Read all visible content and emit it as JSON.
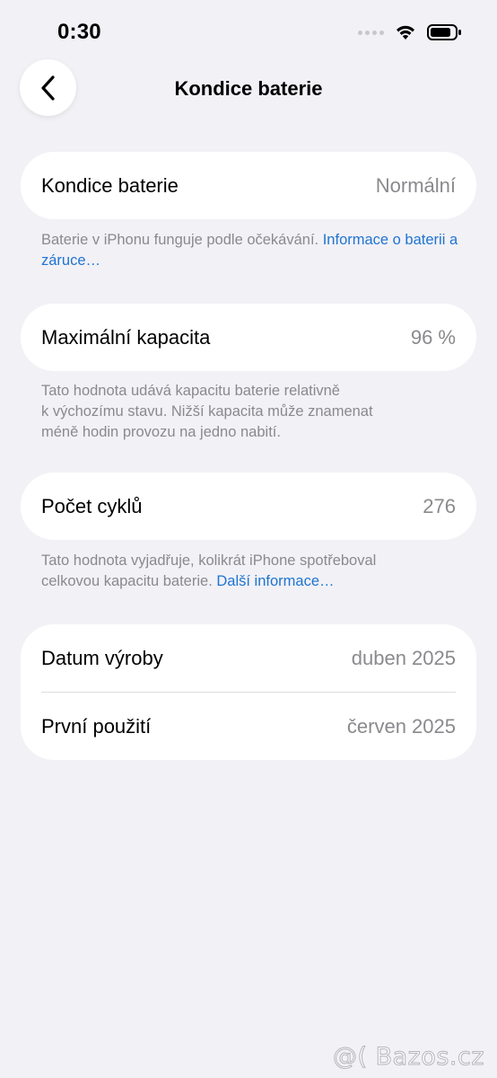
{
  "status_bar": {
    "time": "0:30",
    "icons": [
      "signal-dots-icon",
      "wifi-icon",
      "battery-icon"
    ]
  },
  "nav": {
    "back_icon": "chevron-left-icon",
    "title": "Kondice baterie"
  },
  "health": {
    "label": "Kondice baterie",
    "value": "Normální",
    "note": "Baterie v iPhonu funguje podle očekávání. ",
    "note_link": "Informace o baterii a záruce…"
  },
  "capacity": {
    "label": "Maximální kapacita",
    "value": "96 %",
    "note_lines": [
      "Tato hodnota udává kapacitu baterie relativně",
      "k výchozímu stavu. Nižší kapacita může znamenat",
      "méně hodin provozu na jedno nabití."
    ]
  },
  "cycles": {
    "label": "Počet cyklů",
    "value": "276",
    "note_line1": "Tato hodnota vyjadřuje, kolikrát iPhone spotřeboval",
    "note_line2": "celkovou kapacitu baterie. ",
    "note_link": "Další informace…"
  },
  "dates": {
    "manufacture_label": "Datum výroby",
    "manufacture_value": "duben 2025",
    "first_use_label": "První použití",
    "first_use_value": "červen 2025"
  },
  "watermark": "@( Bazos.cz",
  "colors": {
    "background": "#f2f1f6",
    "card": "#ffffff",
    "secondary_text": "#8a8a8e",
    "link": "#1f74d1"
  }
}
